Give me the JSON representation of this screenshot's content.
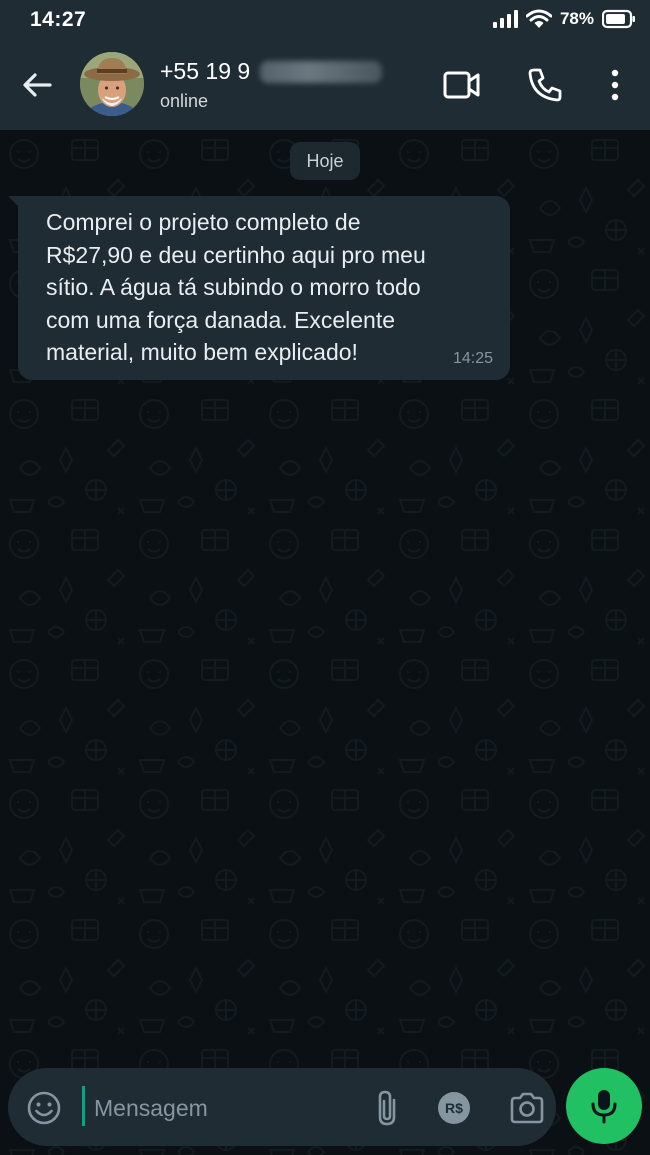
{
  "status_bar": {
    "time": "14:27",
    "battery_percent": "78%",
    "icons": [
      "signal-icon",
      "wifi-icon",
      "battery-icon"
    ]
  },
  "header": {
    "contact_number_visible": "+55 19 9",
    "contact_status": "online",
    "icons": [
      "back-arrow-icon",
      "video-call-icon",
      "phone-icon",
      "more-options-icon"
    ]
  },
  "chat": {
    "date_separator": "Hoje",
    "messages": [
      {
        "direction": "incoming",
        "text": "Comprei o projeto completo de\nR$27,90 e deu certinho aqui pro meu\nsítio. A água tá subindo o morro todo\ncom uma força danada. Excelente\nmaterial, muito bem explicado!",
        "time": "14:25"
      }
    ]
  },
  "composer": {
    "placeholder": "Mensagem",
    "value": "",
    "pay_label": "R$",
    "icons": [
      "emoji-icon",
      "attach-icon",
      "payment-icon",
      "camera-icon",
      "mic-icon"
    ]
  },
  "colors": {
    "header_bg": "#1f2c34",
    "chat_bg": "#0b1014",
    "bubble_bg": "#1f2c34",
    "accent_green": "#21c063",
    "caret_green": "#00a884"
  }
}
